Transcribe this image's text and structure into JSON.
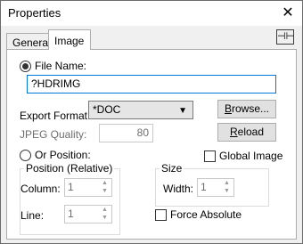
{
  "window": {
    "title": "Properties",
    "close_icon": "close-icon"
  },
  "tabs": [
    {
      "label": "General"
    },
    {
      "label": "Image"
    }
  ],
  "pin_icon": "pin-icon",
  "file": {
    "radio_label": "File Name:",
    "value": "?HDRIMG",
    "checked": true
  },
  "export": {
    "label": "Export Format:",
    "selected": "*DOC",
    "browse_label": "Browse...",
    "browse_key": "B"
  },
  "jpeg": {
    "label": "JPEG Quality:",
    "value": "80",
    "reload_label": "Reload",
    "reload_key": "R"
  },
  "position": {
    "radio_label": "Or Position:",
    "group_label": "Position (Relative)",
    "column_label": "Column:",
    "column_value": "1",
    "line_label": "Line:",
    "line_value": "1"
  },
  "global": {
    "label": "Global Image",
    "checked": false
  },
  "size": {
    "group_label": "Size",
    "width_label": "Width:",
    "width_value": "1"
  },
  "force": {
    "label": "Force Absolute",
    "checked": false
  }
}
